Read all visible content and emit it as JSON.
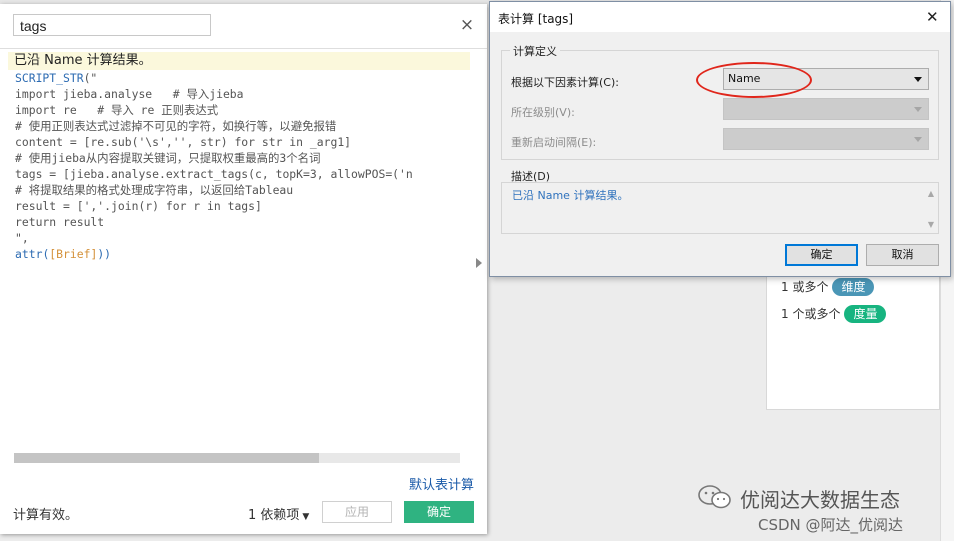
{
  "editor": {
    "name_value": "tags",
    "status_hint": "已沿 Name 计算结果。",
    "code_lines": [
      [
        {
          "t": "SCRIPT_STR",
          "c": "kw"
        },
        {
          "t": "(\"",
          "c": ""
        }
      ],
      [
        {
          "t": "import jieba.analyse   # 导入jieba",
          "c": ""
        }
      ],
      [
        {
          "t": "import re   # 导入 re 正则表达式",
          "c": ""
        }
      ],
      [
        {
          "t": "# 使用正则表达式过滤掉不可见的字符，如换行等，以避免报错",
          "c": ""
        }
      ],
      [
        {
          "t": "content = [re.sub('\\s','', str) for str in _arg1]",
          "c": ""
        }
      ],
      [
        {
          "t": "# 使用jieba从内容提取关键词，只提取权重最高的3个名词",
          "c": ""
        }
      ],
      [
        {
          "t": "tags = [jieba.analyse.extract_tags(c, topK=3, allowPOS=('n",
          "c": ""
        }
      ],
      [
        {
          "t": "# 将提取结果的格式处理成字符串，以返回给Tableau",
          "c": ""
        }
      ],
      [
        {
          "t": "result = [','.join(r) for r in tags]",
          "c": ""
        }
      ],
      [
        {
          "t": "return result",
          "c": ""
        }
      ],
      [
        {
          "t": "\",",
          "c": ""
        }
      ],
      [
        {
          "t": "attr",
          "c": "kw"
        },
        {
          "t": "(",
          "c": "kw"
        },
        {
          "t": "[Brief]",
          "c": "br"
        },
        {
          "t": "))",
          "c": "kw"
        }
      ]
    ],
    "default_table_calc": "默认表计算",
    "valid_text": "计算有效。",
    "dependencies": "1 依赖项",
    "apply_label": "应用",
    "ok_label": "确定",
    "close_glyph": "×"
  },
  "legend": {
    "row1_prefix": "1 或多个",
    "row1_pill": "维度",
    "row2_prefix": "1 个或多个",
    "row2_pill": "度量"
  },
  "dialog": {
    "title": "表计算 [tags]",
    "close_glyph": "✕",
    "group_title": "计算定义",
    "compute_using_label": "根据以下因素计算(C):",
    "compute_using_value": "Name",
    "level_label": "所在级别(V):",
    "restart_label": "重新启动间隔(E):",
    "description_title": "描述(D)",
    "description_text": "已沿 Name 计算结果。",
    "ok_label": "确定",
    "cancel_label": "取消"
  },
  "watermark": {
    "line1": "优阅达大数据生态",
    "line2": "CSDN @阿达_优阅达"
  },
  "colors": {
    "ok_green": "#2fb381",
    "dimension_pill": "#4a96b6",
    "measure_pill": "#17b480",
    "link_blue": "#1a5aa8",
    "highlight_red": "#e0261b"
  }
}
